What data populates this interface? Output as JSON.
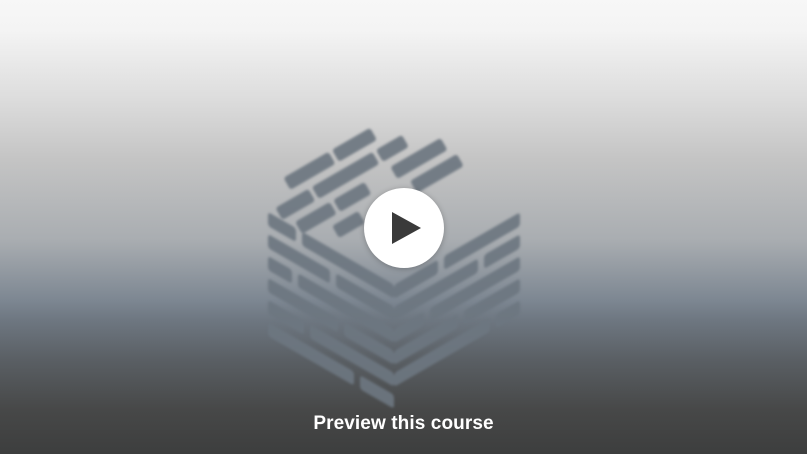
{
  "preview": {
    "cta_label": "Preview this course",
    "play_icon": "play-icon",
    "course_logo_icon": "brick-cube-icon"
  }
}
